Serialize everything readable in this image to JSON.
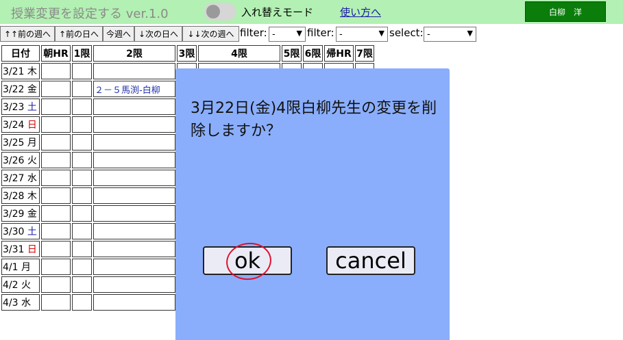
{
  "header": {
    "app_title": "授業変更を設定する ver.1.0",
    "mode_label": "入れ替えモード",
    "howto_link": "使い方へ",
    "user_button": "白柳　洋",
    "colors": {
      "header_bg": "#b3f0b3",
      "user_button_bg": "#0a7d0a"
    }
  },
  "toolbar": {
    "buttons": [
      "↑↑前の週へ",
      "↑前の日へ",
      "今週へ",
      "↓次の日へ",
      "↓↓次の週へ"
    ],
    "filter1_label": "filter:",
    "filter1_value": "-",
    "filter2_label": "filter:",
    "filter2_value": "-",
    "select_label": "select:",
    "select_value": "-"
  },
  "grid": {
    "headers": [
      "日付",
      "朝HR",
      "1限",
      "2限",
      "3限",
      "4限",
      "5限",
      "6限",
      "帰HR",
      "7限"
    ],
    "rows": [
      {
        "date": "3/21 ",
        "dow": "木",
        "dow_type": "weekday",
        "cells": [
          "",
          "",
          "",
          "",
          "",
          "",
          "",
          "",
          ""
        ]
      },
      {
        "date": "3/22 ",
        "dow": "金",
        "dow_type": "weekday",
        "cells": [
          "",
          "",
          "２－５馬渕-白柳",
          "",
          "",
          "",
          "",
          "",
          ""
        ]
      },
      {
        "date": "3/23 ",
        "dow": "土",
        "dow_type": "sat",
        "cells": [
          "",
          "",
          "",
          "",
          "",
          "",
          "",
          "",
          ""
        ]
      },
      {
        "date": "3/24 ",
        "dow": "日",
        "dow_type": "sun",
        "cells": [
          "",
          "",
          "",
          "",
          "",
          "",
          "",
          "",
          ""
        ]
      },
      {
        "date": "3/25 ",
        "dow": "月",
        "dow_type": "weekday",
        "cells": [
          "",
          "",
          "",
          "",
          "",
          "",
          "",
          "",
          ""
        ]
      },
      {
        "date": "3/26 ",
        "dow": "火",
        "dow_type": "weekday",
        "cells": [
          "",
          "",
          "",
          "",
          "",
          "",
          "",
          "",
          ""
        ]
      },
      {
        "date": "3/27 ",
        "dow": "水",
        "dow_type": "weekday",
        "cells": [
          "",
          "",
          "",
          "",
          "",
          "",
          "",
          "",
          ""
        ]
      },
      {
        "date": "3/28 ",
        "dow": "木",
        "dow_type": "weekday",
        "cells": [
          "",
          "",
          "",
          "",
          "",
          "",
          "",
          "",
          ""
        ]
      },
      {
        "date": "3/29 ",
        "dow": "金",
        "dow_type": "weekday",
        "cells": [
          "",
          "",
          "",
          "",
          "",
          "",
          "",
          "",
          ""
        ]
      },
      {
        "date": "3/30 ",
        "dow": "土",
        "dow_type": "sat",
        "cells": [
          "",
          "",
          "",
          "",
          "",
          "",
          "",
          "",
          ""
        ]
      },
      {
        "date": "3/31 ",
        "dow": "日",
        "dow_type": "sun",
        "cells": [
          "",
          "",
          "",
          "",
          "",
          "",
          "",
          "",
          ""
        ]
      },
      {
        "date": "4/1 ",
        "dow": "月",
        "dow_type": "weekday",
        "cells": [
          "",
          "",
          "",
          "",
          "",
          "",
          "",
          "",
          ""
        ]
      },
      {
        "date": "4/2 ",
        "dow": "火",
        "dow_type": "weekday",
        "cells": [
          "",
          "",
          "",
          "",
          "",
          "",
          "",
          "",
          ""
        ]
      },
      {
        "date": "4/3 ",
        "dow": "水",
        "dow_type": "weekday",
        "cells": [
          "",
          "",
          "",
          "",
          "",
          "",
          "",
          "",
          ""
        ]
      }
    ]
  },
  "dialog": {
    "message": "3月22日(金)4限白柳先生の変更を削除しますか？",
    "ok_label": "ok",
    "cancel_label": "cancel",
    "bg_color": "#8aaefc"
  }
}
